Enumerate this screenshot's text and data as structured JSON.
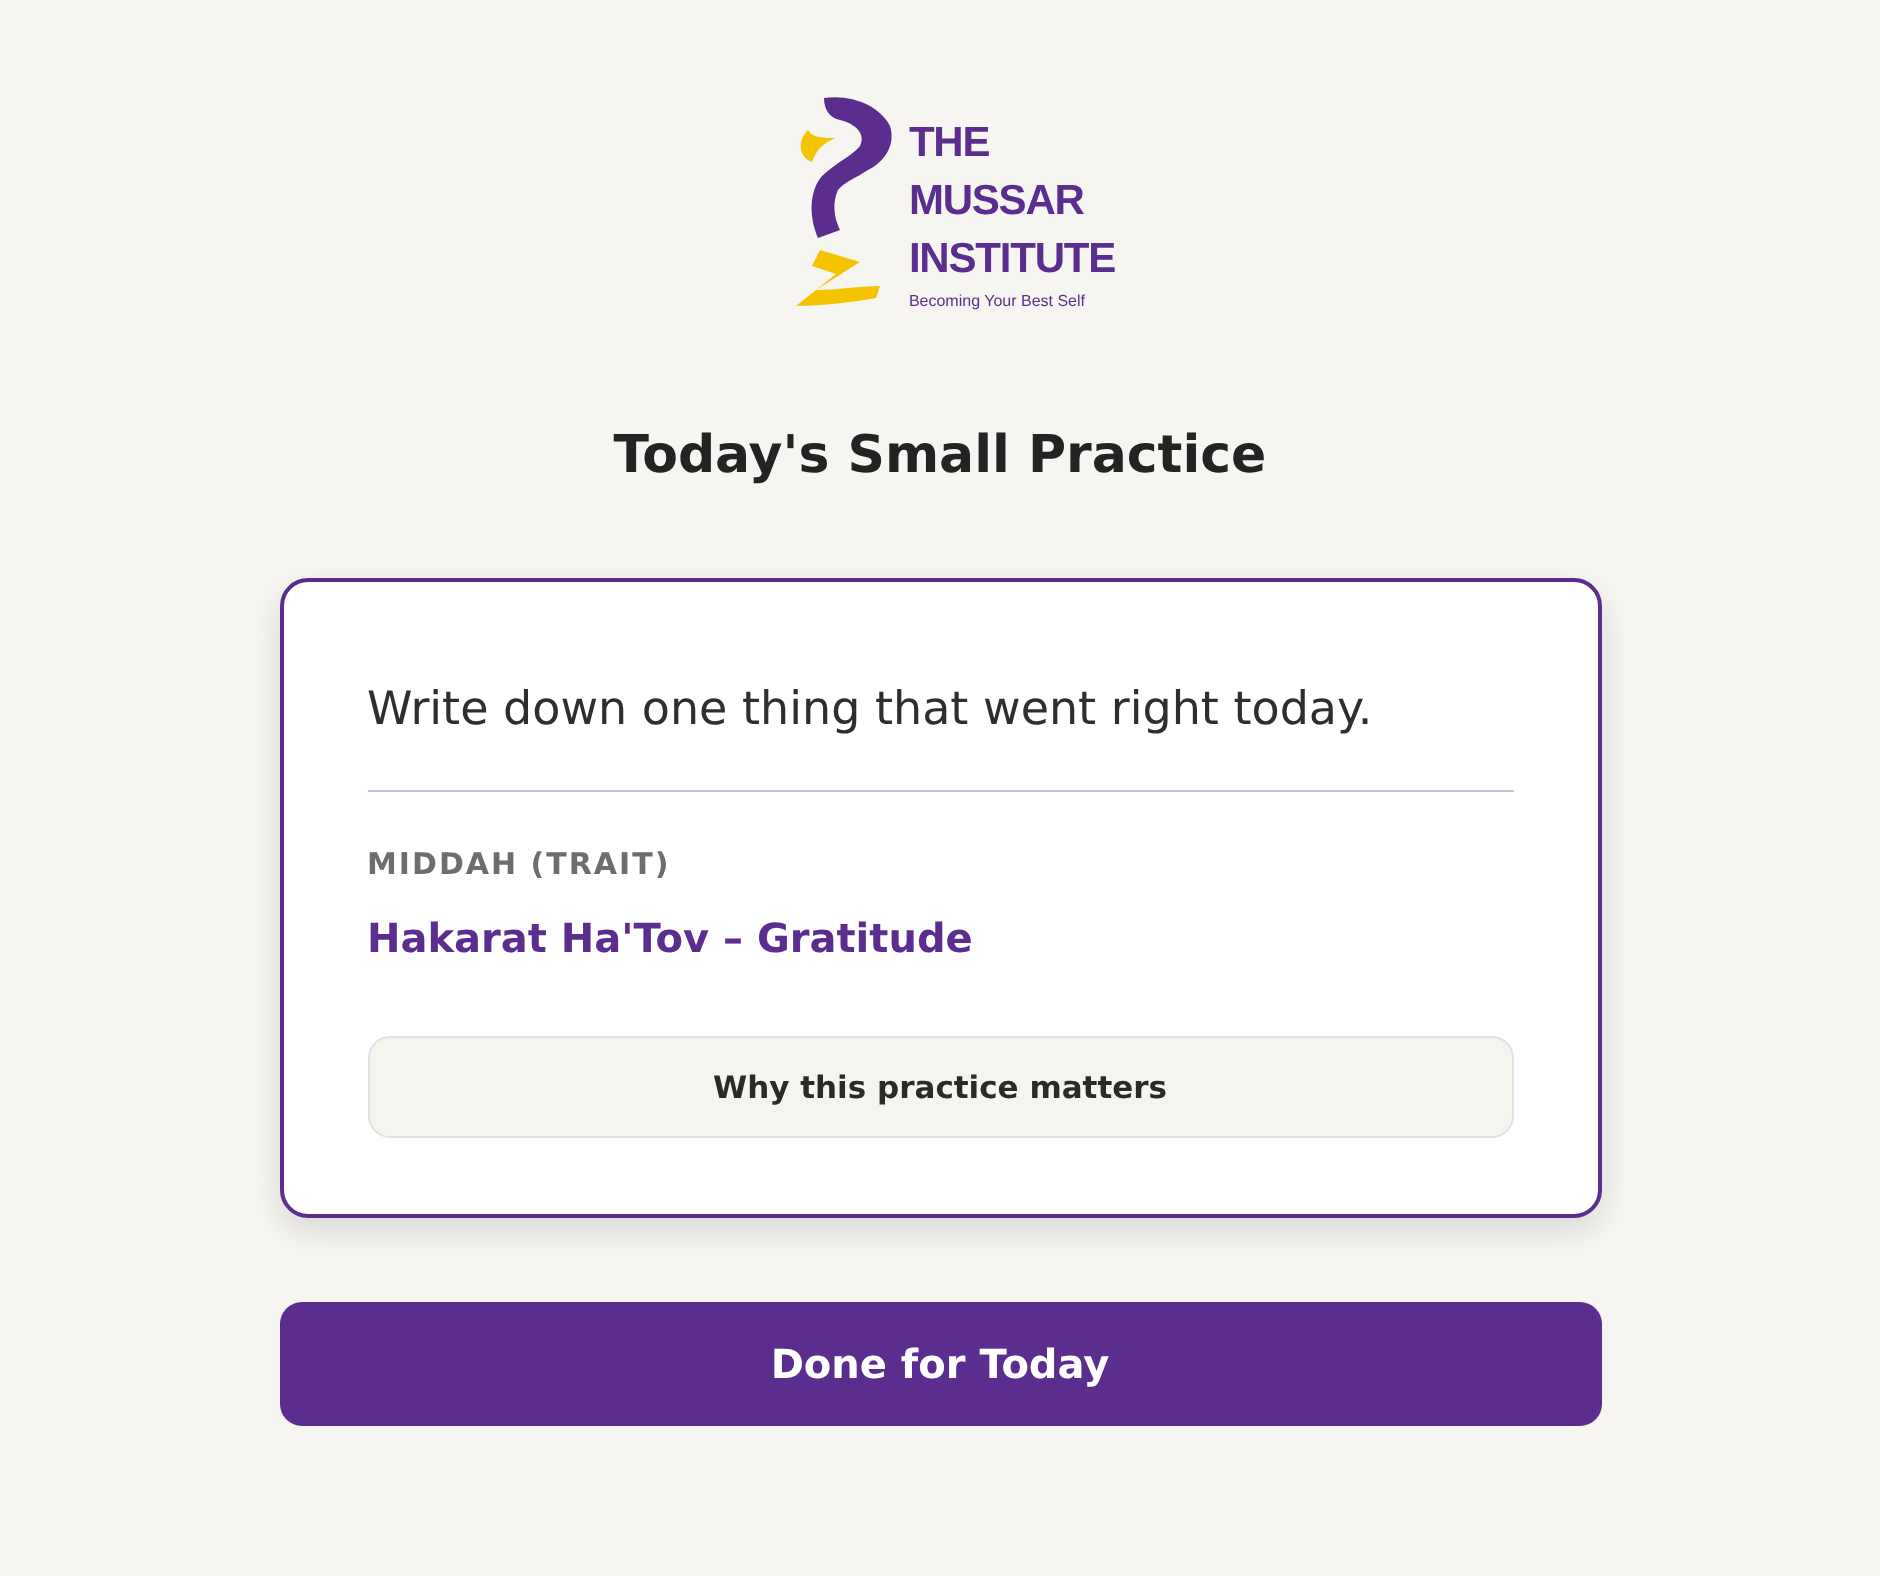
{
  "logo": {
    "lines": [
      "THE",
      "MUSSAR",
      "INSTITUTE"
    ],
    "tagline": "Becoming Your Best Self"
  },
  "title": "Today's Small Practice",
  "card": {
    "prompt": "Write down one thing that went right today.",
    "trait_label": "MIDDAH (TRAIT)",
    "trait": "Hakarat Ha'Tov – Gratitude",
    "info_button": "Why this practice matters"
  },
  "primary_button": "Done for Today"
}
